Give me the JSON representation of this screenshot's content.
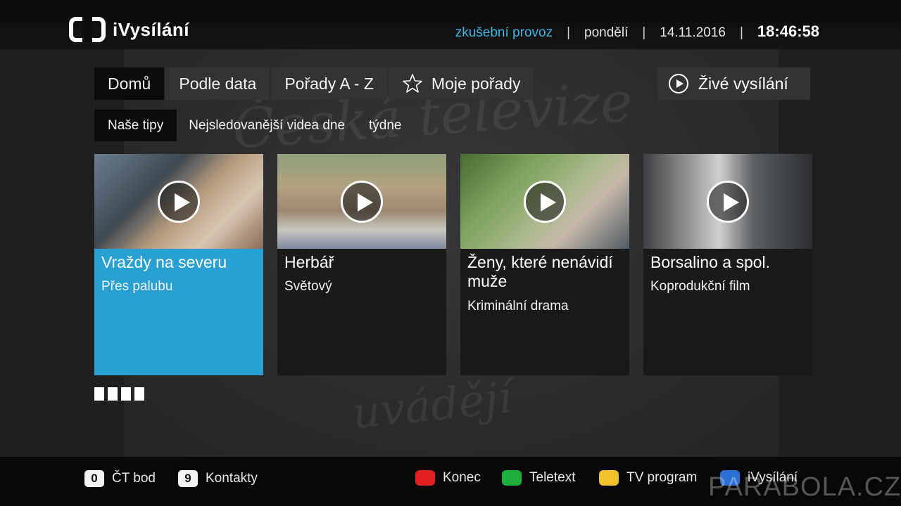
{
  "header": {
    "logo_text": "iVysílání",
    "trial_text": "zkušební provoz",
    "separator": "|",
    "day": "pondělí",
    "date": "14.11.2016",
    "time": "18:46:58"
  },
  "main_nav": {
    "tabs": [
      {
        "label": "Domů",
        "active": true
      },
      {
        "label": "Podle data",
        "active": false
      },
      {
        "label": "Pořady A - Z",
        "active": false
      },
      {
        "label": "Moje pořady",
        "active": false,
        "icon": "star-icon"
      }
    ],
    "live_label": "Živé vysílání"
  },
  "sub_nav": {
    "tabs": [
      {
        "label": "Naše tipy",
        "active": true
      },
      {
        "label": "Nejsledovanější videa dne",
        "active": false
      },
      {
        "label": "týdne",
        "active": false
      }
    ]
  },
  "cards": [
    {
      "title": "Vraždy na severu",
      "subtitle": "Přes palubu",
      "selected": true
    },
    {
      "title": "Herbář",
      "subtitle": "Světový",
      "selected": false
    },
    {
      "title": "Ženy, které nenávidí muže",
      "subtitle": "Kriminální drama",
      "selected": false
    },
    {
      "title": "Borsalino a spol.",
      "subtitle": "Koprodukční film",
      "selected": false
    }
  ],
  "pager": {
    "count": 4
  },
  "footer": {
    "num_keys": [
      {
        "key": "0",
        "label": "ČT bod"
      },
      {
        "key": "9",
        "label": "Kontakty"
      }
    ],
    "color_keys": [
      {
        "color": "#e02020",
        "label": "Konec"
      },
      {
        "color": "#1fae3c",
        "label": "Teletext"
      },
      {
        "color": "#f0c22a",
        "label": "TV program"
      },
      {
        "color": "#2a6fd6",
        "label": "iVysílání"
      }
    ]
  },
  "watermark": "PARABOLA.CZ",
  "colors": {
    "accent": "#29a0d2",
    "trial": "#3fb3e2"
  }
}
